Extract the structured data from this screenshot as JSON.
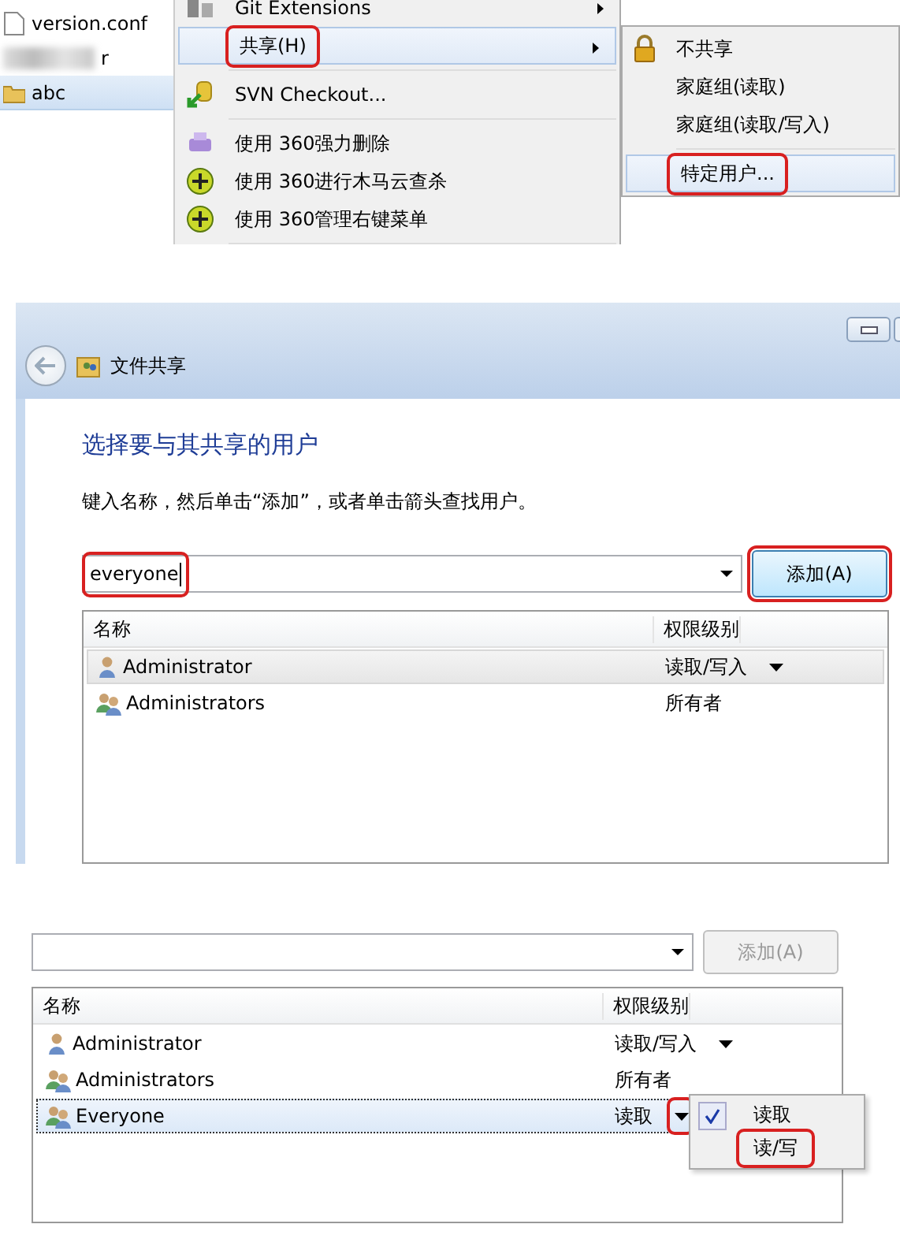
{
  "explorer": {
    "files": [
      {
        "name": "version.conf",
        "kind": "file",
        "selected": false
      },
      {
        "name": "r",
        "kind": "obscured",
        "selected": false
      },
      {
        "name": "abc",
        "kind": "folder",
        "selected": true
      }
    ],
    "context_menu": [
      {
        "kind": "item",
        "label": "Git Extensions",
        "submenu": true,
        "highlighted": false,
        "annotated": false
      },
      {
        "kind": "item",
        "label": "共享(H)",
        "submenu": true,
        "highlighted": true,
        "annotated": true
      },
      {
        "kind": "separator"
      },
      {
        "kind": "item",
        "label": "SVN Checkout...",
        "submenu": false,
        "highlighted": false,
        "annotated": false
      },
      {
        "kind": "separator"
      },
      {
        "kind": "item",
        "label": "使用 360强力删除",
        "submenu": false,
        "highlighted": false,
        "annotated": false
      },
      {
        "kind": "item",
        "label": "使用 360进行木马云查杀",
        "submenu": false,
        "highlighted": false,
        "annotated": false
      },
      {
        "kind": "item",
        "label": "使用 360管理右键菜单",
        "submenu": false,
        "highlighted": false,
        "annotated": false
      },
      {
        "kind": "separator"
      }
    ],
    "share_submenu": [
      {
        "kind": "item",
        "label": "不共享",
        "highlighted": false,
        "annotated": false
      },
      {
        "kind": "item",
        "label": "家庭组(读取)",
        "highlighted": false,
        "annotated": false
      },
      {
        "kind": "item",
        "label": "家庭组(读取/写入)",
        "highlighted": false,
        "annotated": false
      },
      {
        "kind": "separator"
      },
      {
        "kind": "item",
        "label": "特定用户...",
        "highlighted": true,
        "annotated": true
      }
    ]
  },
  "share_dialog": {
    "title": "文件共享",
    "heading": "选择要与其共享的用户",
    "instruction": "键入名称，然后单击“添加”，或者单击箭头查找用户。",
    "name_field": {
      "value": "everyone",
      "annotated": true
    },
    "add_button": {
      "label": "添加(A)",
      "disabled": false,
      "annotated": true
    },
    "columns": [
      "名称",
      "权限级别"
    ],
    "rows": [
      {
        "name": "Administrator",
        "kind": "user",
        "permission": "读取/写入",
        "has_dropdown": true,
        "selected": true,
        "dropdown_annotated": false
      },
      {
        "name": "Administrators",
        "kind": "group",
        "permission": "所有者",
        "has_dropdown": false,
        "selected": false
      }
    ]
  },
  "share_dialog_after": {
    "name_field": {
      "annotated": false
    },
    "add_button": {
      "label": "添加(A)",
      "disabled": true,
      "annotated": false
    },
    "columns": [
      "名称",
      "权限级别"
    ],
    "rows": [
      {
        "name": "Administrator",
        "kind": "user",
        "permission": "读取/写入",
        "has_dropdown": true,
        "selected": false,
        "dropdown_annotated": false
      },
      {
        "name": "Administrators",
        "kind": "group",
        "permission": "所有者",
        "has_dropdown": false,
        "selected": false
      },
      {
        "name": "Everyone",
        "kind": "group",
        "permission": "读取",
        "has_dropdown": true,
        "selected": true,
        "dropdown_annotated": true
      }
    ],
    "permission_menu": [
      {
        "label": "读取",
        "checked": true,
        "annotated": false
      },
      {
        "label": "读/写",
        "checked": false,
        "annotated": true
      }
    ]
  }
}
